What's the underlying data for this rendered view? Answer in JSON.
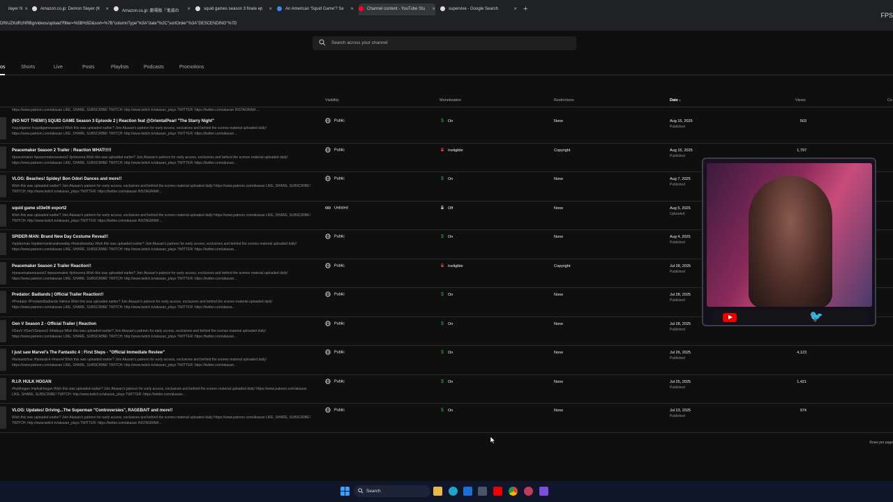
{
  "browser": {
    "tabs": [
      {
        "label": "ilayer N",
        "color": "#888888"
      },
      {
        "label": "Amazon.co.jp: Demon Slayer (K",
        "color": "#dddddd"
      },
      {
        "label": "Amazon.co.jp: 劇場版「鬼滅の",
        "color": "#dddddd"
      },
      {
        "label": "squid games season 3 finale ep",
        "color": "#dddddd"
      },
      {
        "label": "An American 'Squid Game'? Se",
        "color": "#4285f4"
      },
      {
        "label": "Channel content - YouTube Stu",
        "color": "#ff0033"
      },
      {
        "label": "supervive - Google Search",
        "color": "#dddddd"
      }
    ],
    "new_tab": "+",
    "url": "DRIUZKdRzNRBg/videos/upload?filter=%5B%5D&sort=%7B\"columnType\"%3A\"date\"%2C\"sortOrder\"%3A\"DESCENDING\"%7D",
    "fps": "FPS"
  },
  "search": {
    "placeholder": "Search across your channel"
  },
  "nav_tabs": [
    "os",
    "Shorts",
    "Live",
    "Posts",
    "Playlists",
    "Podcasts",
    "Promotions"
  ],
  "columns": {
    "visibility": "Visibility",
    "monetization": "Monetization",
    "restrictions": "Restrictions",
    "date": "Date ↓",
    "views": "Views",
    "comments": "Co"
  },
  "partial_top_desc": "https://www.patreon.com/akasan LIKE, SHARE, SUBSCRIBE! TWITCH: http://www.twitch.tv/akasan_plays TWITTER: https://twitter.com/akasan INSTAGRAM:...",
  "videos": [
    {
      "title": "(NO NOT THEM!!) SQUID GAME Season 3 Episode 2 | Reaction feat @OrientalPearl \"The Starry Night\"",
      "desc": "#squidgame #squidgameseason3 Wish this was uploaded earlier? Join Akasan's patreon for early access, exclusives and behind the scenes material uploaded daily! https://www.patreon.com/akasan LIKE, SHARE, SUBSCRIBE! TWITCH: http://www.twitch.tv/akasan_plays TWITTER: https://twitter.com/akasan...",
      "visibility": "Public",
      "monetization": "On",
      "mon_state": "on",
      "restrictions": "None",
      "date": "Aug 15, 2025",
      "status": "Published",
      "views": "503"
    },
    {
      "title": "Peacemaker Season 2 Trailer : Reaction WHAT!!!!!",
      "desc": "#peacemaker #peacemakerseason2 #johncena Wish this was uploaded earlier? Join Akasan's patreon for early access, exclusives and behind the scenes material uploaded daily! https://www.patreon.com/akasan LIKE, SHARE, SUBSCRIBE! TWITCH: http://www.twitch.tv/akasan_plays TWITTER: https://twitter.com/akasan...",
      "visibility": "Public",
      "monetization": "Ineligible",
      "mon_state": "no",
      "restrictions": "Copyright",
      "date": "Aug 15, 2025",
      "status": "Published",
      "views": "1,797"
    },
    {
      "title": "VLOG: Beaches! Spidey! Bon Odori Dances and more!!",
      "desc": "Wish this was uploaded earlier? Join Akasan's patreon for early access, exclusives and behind the scenes material uploaded daily! https://www.patreon.com/akasan LIKE, SHARE, SUBSCRIBE! TWITCH: http://www.twitch.tv/akasan_plays TWITTER: https://twitter.com/akasan INSTAGRAM:...",
      "visibility": "Public",
      "monetization": "On",
      "mon_state": "on",
      "restrictions": "None",
      "date": "Aug 7, 2025",
      "status": "Published",
      "views": ""
    },
    {
      "title": "squid game s03e06 export2",
      "desc": "Wish this was uploaded earlier? Join Akasan's patreon for early access, exclusives and behind the scenes material uploaded daily! https://www.patreon.com/akasan LIKE, SHARE, SUBSCRIBE! TWITCH: http://www.twitch.tv/akasan_plays TWITTER: https://twitter.com/akasan INSTAGRAM:...",
      "visibility": "Unlisted",
      "monetization": "Off",
      "mon_state": "off",
      "restrictions": "None",
      "date": "Aug 5, 2025",
      "status": "Uploaded",
      "views": ""
    },
    {
      "title": "SPIDER-MAN: Brand New Day Costume Reveal!!",
      "desc": "#spiderman #spidermanbrandnewday #brandnewday Wish this was uploaded earlier? Join Akasan's patreon for early access, exclusives and behind the scenes material uploaded daily! https://www.patreon.com/akasan LIKE, SHARE, SUBSCRIBE! TWITCH: http://www.twitch.tv/akasan_plays TWITTER: https://twitter.com/akasan...",
      "visibility": "Public",
      "monetization": "On",
      "mon_state": "on",
      "restrictions": "None",
      "date": "Aug 4, 2025",
      "status": "Published",
      "views": ""
    },
    {
      "title": "Peacemaker Season 2 Trailer Reaction!!",
      "desc": "#peacemakerseason2 #peacemaker #johncena Wish this was uploaded earlier? Join Akasan's patreon for early access, exclusives and behind the scenes material uploaded daily! https://www.patreon.com/akasan LIKE, SHARE, SUBSCRIBE! TWITCH: http://www.twitch.tv/akasan_plays TWITTER: https://twitter.com/akasan...",
      "visibility": "Public",
      "monetization": "Ineligible",
      "mon_state": "no",
      "restrictions": "Copyright",
      "date": "Jul 28, 2025",
      "status": "Published",
      "views": ""
    },
    {
      "title": "Predator: Badlands | Official Trailer Reaction!!",
      "desc": "#Predator #PredatorBadlands #aliens Wish this was uploaded earlier? Join Akasan's patreon for early access, exclusives and behind the scenes material uploaded daily! https://www.patreon.com/akasan LIKE, SHARE, SUBSCRIBE! TWITCH: http://www.twitch.tv/akasan_plays TWITTER: https://twitter.com/akasa...",
      "visibility": "Public",
      "monetization": "On",
      "mon_state": "on",
      "restrictions": "None",
      "date": "Jul 28, 2025",
      "status": "Published",
      "views": ""
    },
    {
      "title": "Gen V Season 2 - Official Trailer | Reaction",
      "desc": "#GenV #GenVSeason2 #theboys Wish this was uploaded earlier? Join Akasan's patreon for early access, exclusives and behind the scenes material uploaded daily! https://www.patreon.com/akasan LIKE, SHARE, SUBSCRIBE! TWITCH: http://www.twitch.tv/akasan_plays TWITTER: https://twitter.com/akasan...",
      "visibility": "Public",
      "monetization": "On",
      "mon_state": "on",
      "restrictions": "None",
      "date": "Jul 28, 2025",
      "status": "Published",
      "views": "591"
    },
    {
      "title": "I just saw Marvel's The Fantastic 4 : First Steps - \"Official Immediate Review\"",
      "desc": "#fantasticfour #fantastic4 #marvel Wish this was uploaded earlier? Join Akasan's patreon for early access, exclusives and behind the scenes material uploaded daily! https://www.patreon.com/akasan LIKE, SHARE, SUBSCRIBE! TWITCH: http://www.twitch.tv/akasan_plays TWITTER: https://twitter.com/akasan...",
      "visibility": "Public",
      "monetization": "On",
      "mon_state": "on",
      "restrictions": "None",
      "date": "Jul 26, 2025",
      "status": "Published",
      "views": "4,123"
    },
    {
      "title": "R.I.P. HULK HOGAN",
      "desc": "#hulkhogan #riphulkhogan Wish this was uploaded earlier? Join Akasan's patreon for early access, exclusives and behind the scenes material uploaded daily! https://www.patreon.com/akasan LIKE, SHARE, SUBSCRIBE! TWITCH: http://www.twitch.tv/akasan_plays TWITTER: https://twitter.com/akasan...",
      "visibility": "Public",
      "monetization": "On",
      "mon_state": "on",
      "restrictions": "None",
      "date": "Jul 25, 2025",
      "status": "Published",
      "views": "1,421"
    },
    {
      "title": "VLOG: Updates! Driving...The Superman \"Controversies\", RAGEBAIT and more!!",
      "desc": "Wish this was uploaded earlier? Join Akasan's patreon for early access, exclusives and behind the scenes material uploaded daily! https://www.patreon.com/akasan LIKE, SHARE, SUBSCRIBE! TWITCH: http://www.twitch.tv/akasan_plays TWITTER: https://twitter.com/akasan INSTAGRAM:...",
      "visibility": "Public",
      "monetization": "On",
      "mon_state": "on",
      "restrictions": "None",
      "date": "Jul 23, 2025",
      "status": "Published",
      "views": "974"
    }
  ],
  "rows_per_page": "Rows per page",
  "taskbar": {
    "search_label": "Search"
  }
}
